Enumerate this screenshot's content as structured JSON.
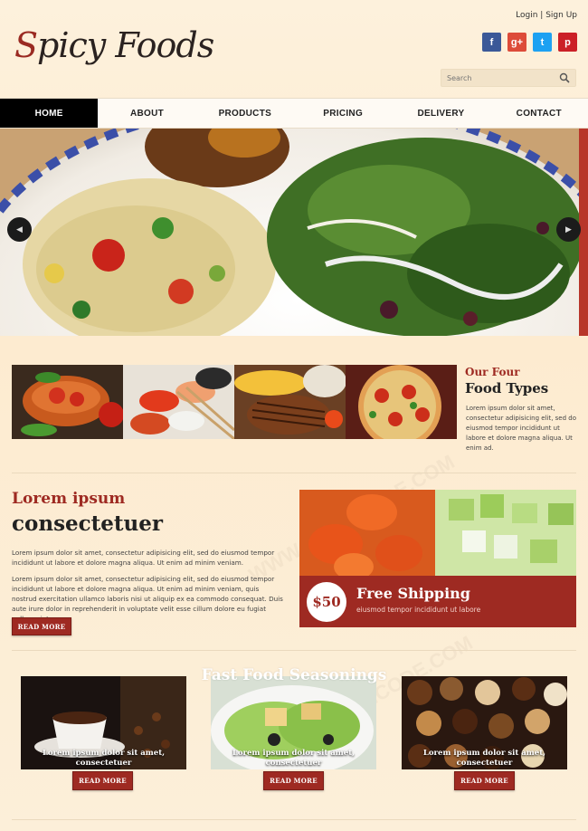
{
  "brand": {
    "logo_first": "S",
    "logo_rest": "picy Foods"
  },
  "header": {
    "login": "Login",
    "separator": " | ",
    "signup": "Sign Up",
    "search_placeholder": "Search",
    "social": [
      {
        "icon": "facebook-icon",
        "glyph": "f",
        "color": "#3b5998"
      },
      {
        "icon": "google-plus-icon",
        "glyph": "g+",
        "color": "#dd4b39"
      },
      {
        "icon": "twitter-icon",
        "glyph": "t",
        "color": "#1da1f2"
      },
      {
        "icon": "pinterest-icon",
        "glyph": "p",
        "color": "#cb2027"
      }
    ]
  },
  "nav": [
    "HOME",
    "ABOUT",
    "PRODUCTS",
    "PRICING",
    "DELIVERY",
    "CONTACT"
  ],
  "slider": {
    "prev_icon": "chevron-left-icon",
    "next_icon": "chevron-right-icon"
  },
  "food_types": {
    "title_top": "Our Four",
    "title_main": "Food Types",
    "text": "Lorem ipsum dolor sit amet, consectetur adipisicing elit, sed do eiusmod tempor incididunt ut labore et dolore magna aliqua. Ut enim ad."
  },
  "lorem": {
    "heading1": "Lorem ipsum",
    "heading2": "consectetuer",
    "para1": "Lorem ipsum dolor sit amet, consectetur adipisicing elit, sed do eiusmod tempor incididunt ut labore et dolore magna aliqua. Ut enim ad minim veniam.",
    "para2": "Lorem ipsum dolor sit amet, consectetur adipisicing elit, sed do eiusmod tempor incididunt ut labore et dolore magna aliqua. Ut enim ad minim veniam, quis nostrud exercitation ullamco laboris nisi ut aliquip ex ea commodo consequat. Duis aute irure dolor in reprehenderit in voluptate velit esse cillum dolore eu fugiat nulla pariatur.",
    "button": "READ MORE"
  },
  "shipping": {
    "price": "$50",
    "title": "Free Shipping",
    "subtitle": "eiusmod tempor incididunt ut labore"
  },
  "seasonings": {
    "title": "Fast Food Seasonings",
    "cards": [
      {
        "caption": "Lorem ipsum dolor sit amet, consectetuer",
        "button": "READ MORE"
      },
      {
        "caption": "Lorem ipsum dolor sit amet, consectetuer",
        "button": "READ MORE"
      },
      {
        "caption": "Lorem ipsum dolor sit amet, consectetuer",
        "button": "READ MORE"
      }
    ]
  },
  "colors": {
    "accent": "#9e2a22",
    "nav_active": "#000000",
    "background": "#fdf1dc"
  }
}
